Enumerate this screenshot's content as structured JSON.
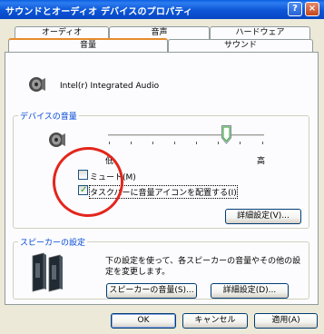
{
  "window": {
    "title": "サウンドとオーディオ デバイスのプロパティ",
    "help_label": "?",
    "close_label": "×"
  },
  "tabs": {
    "row_top": [
      {
        "label": "オーディオ"
      },
      {
        "label": "音声"
      },
      {
        "label": "ハードウェア"
      }
    ],
    "row_bottom": [
      {
        "label": "音量",
        "active": true
      },
      {
        "label": "サウンド"
      }
    ]
  },
  "device": {
    "name": "Intel(r) Integrated Audio",
    "icon": "speaker-volume-icon"
  },
  "device_volume": {
    "group_title": "デバイスの音量",
    "low_label": "低",
    "high_label": "高",
    "level": 0.75,
    "mute_label": "ミュート(M)",
    "mute_checked": false,
    "taskbar_icon_label": "タスクバーに音量アイコンを配置する(I)",
    "taskbar_icon_checked": true,
    "advanced_button": "詳細設定(V)..."
  },
  "speaker_settings": {
    "group_title": "スピーカーの設定",
    "description": "下の設定を使って、各スピーカーの音量やその他の設定を変更します。",
    "volume_button": "スピーカーの音量(S)...",
    "advanced_button": "詳細設定(D)...",
    "icon": "speakers-icon"
  },
  "footer": {
    "ok": "OK",
    "cancel": "キャンセル",
    "apply": "適用(A)"
  },
  "colors": {
    "titlebar": "#0a5ee0",
    "group_title": "#0046d5",
    "annotation_circle": "#e3261c",
    "tab_highlight": "#e68b2c"
  }
}
